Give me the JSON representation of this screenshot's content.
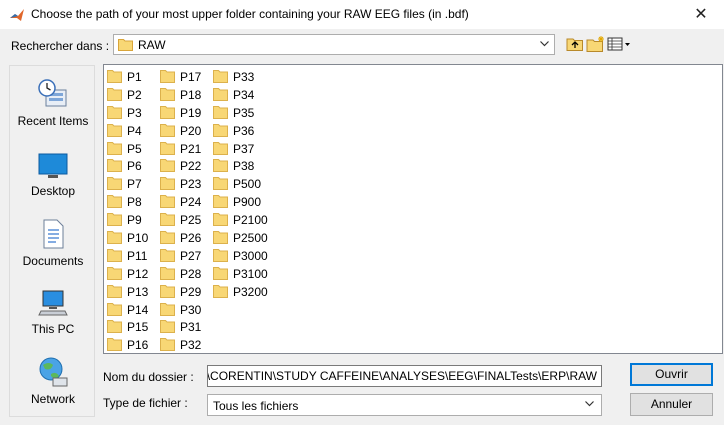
{
  "window": {
    "title": "Choose the path of your most upper folder containing your RAW EEG files (in .bdf)",
    "close_glyph": "✕"
  },
  "lookin": {
    "label": "Rechercher dans :",
    "value": "RAW"
  },
  "places": [
    {
      "label": "Recent Items",
      "icon": "recent-items-icon"
    },
    {
      "label": "Desktop",
      "icon": "desktop-icon"
    },
    {
      "label": "Documents",
      "icon": "documents-icon"
    },
    {
      "label": "This PC",
      "icon": "this-pc-icon"
    },
    {
      "label": "Network",
      "icon": "network-icon"
    }
  ],
  "files": {
    "col1": [
      "P1",
      "P2",
      "P3",
      "P4",
      "P5",
      "P6",
      "P7",
      "P8",
      "P9",
      "P10",
      "P11",
      "P12",
      "P13",
      "P14",
      "P15",
      "P16"
    ],
    "col2": [
      "P17",
      "P18",
      "P19",
      "P20",
      "P21",
      "P22",
      "P23",
      "P24",
      "P25",
      "P26",
      "P27",
      "P28",
      "P29",
      "P30",
      "P31",
      "P32"
    ],
    "col3": [
      "P33",
      "P34",
      "P35",
      "P36",
      "P37",
      "P38",
      "P500",
      "P900",
      "P2100",
      "P2500",
      "P3000",
      "P3100",
      "P3200"
    ]
  },
  "folder_name": {
    "label": "Nom du dossier :",
    "value": "ıbox\\CORENTIN\\STUDY CAFFEINE\\ANALYSES\\EEG\\FINALTests\\ERP\\RAW"
  },
  "file_type": {
    "label": "Type de fichier :",
    "value": "Tous les fichiers"
  },
  "buttons": {
    "open": "Ouvrir",
    "cancel": "Annuler"
  },
  "colors": {
    "folder": "#f8d775",
    "accent": "#0078d7"
  }
}
